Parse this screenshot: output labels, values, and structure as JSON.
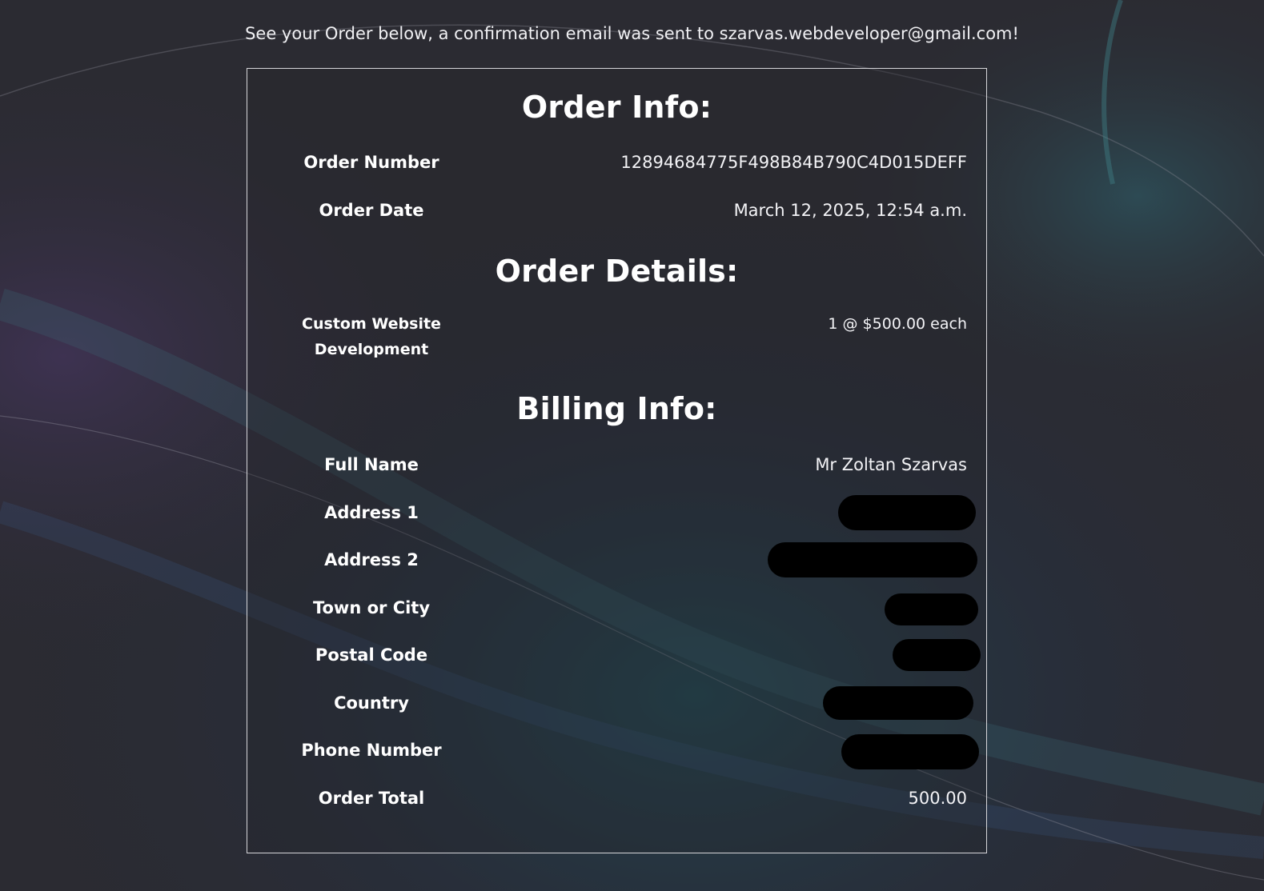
{
  "notice": "See your Order below, a confirmation email was sent to szarvas.webdeveloper@gmail.com!",
  "order_info": {
    "title": "Order Info:",
    "order_number_label": "Order Number",
    "order_number_value": "12894684775F498B84B790C4D015DEFF",
    "order_date_label": "Order Date",
    "order_date_value": "March 12, 2025, 12:54 a.m."
  },
  "order_details": {
    "title": "Order Details:",
    "item_name_line1": "Custom Website",
    "item_name_line2": "Development",
    "item_qty_price": "1 @ $500.00 each"
  },
  "billing_info": {
    "title": "Billing Info:",
    "full_name_label": "Full Name",
    "full_name_value": "Mr Zoltan Szarvas",
    "address1_label": "Address 1",
    "address2_label": "Address 2",
    "town_label": "Town or City",
    "postal_label": "Postal Code",
    "country_label": "Country",
    "phone_label": "Phone Number",
    "total_label": "Order Total",
    "total_value": "500.00"
  },
  "colors": {
    "background": "#2a2a31",
    "border": "#d6d6da",
    "text": "#ffffff",
    "redaction": "#000000"
  }
}
